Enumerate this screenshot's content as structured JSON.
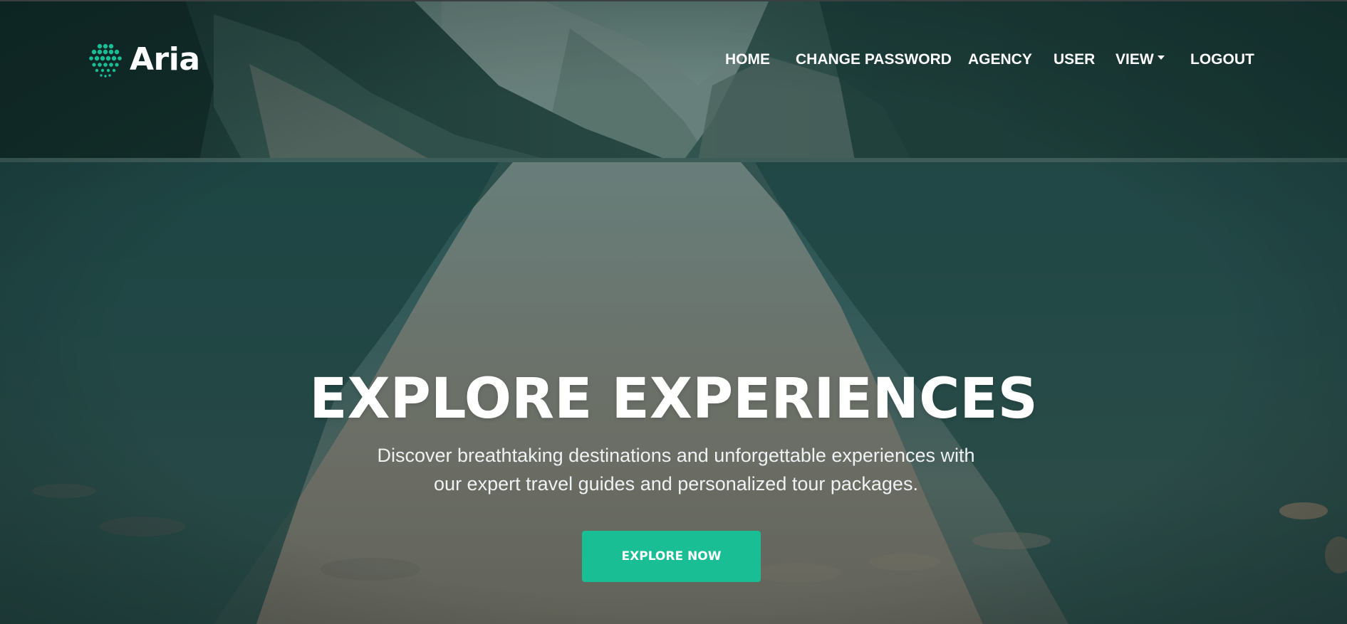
{
  "brand": {
    "name": "Aria",
    "icon": "dot-grid-logo-icon",
    "accent": "#19be94"
  },
  "nav": {
    "items": [
      {
        "label": "HOME"
      },
      {
        "label": "CHANGE PASSWORD"
      },
      {
        "label": "AGENCY"
      },
      {
        "label": "USER"
      },
      {
        "label": "VIEW",
        "dropdown": true,
        "icon": "caret-down-icon"
      },
      {
        "label": "LOGOUT"
      }
    ]
  },
  "hero": {
    "title": "EXPLORE EXPERIENCES",
    "subtitle_line1": "Discover breathtaking destinations and unforgettable experiences with",
    "subtitle_line2": "our expert travel guides and personalized tour packages.",
    "cta_label": "EXPLORE NOW",
    "cta_color": "#19be94",
    "background": "mountain-lake-photo"
  }
}
